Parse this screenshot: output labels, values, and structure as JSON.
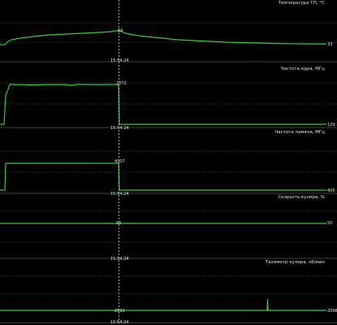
{
  "panels": [
    {
      "title": "Температура ГП, °С",
      "cursor_value": "54",
      "current_value": "33",
      "cursor_time": "15:54:24"
    },
    {
      "title": "Частота ядра, МГц",
      "cursor_value": "1072",
      "current_value": "129",
      "cursor_time": "15:54:24"
    },
    {
      "title": "Частота памяти, МГц",
      "cursor_value": "4007",
      "current_value": "405",
      "cursor_time": "15:54:24"
    },
    {
      "title": "Скорость кулера, %",
      "cursor_value": "50",
      "current_value": "50",
      "cursor_time": "15:54:24"
    },
    {
      "title": "Тахометр кулера, об/мин",
      "cursor_value": "2101",
      "current_value": "2096",
      "cursor_time": "15:54:24"
    }
  ],
  "colors": {
    "background": "#000000",
    "trace": "#3ec63e",
    "grid": "#1f3a1f",
    "cursor": "#c8c8c8",
    "text": "#e6e6e6"
  }
}
